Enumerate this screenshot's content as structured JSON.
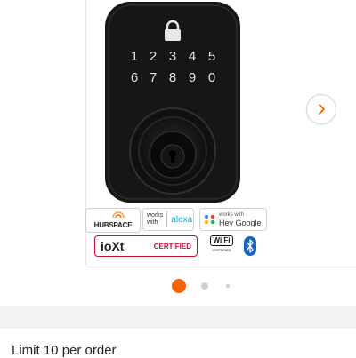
{
  "product": {
    "keypad_row1": [
      "1",
      "2",
      "3",
      "4",
      "5"
    ],
    "keypad_row2": [
      "6",
      "7",
      "8",
      "9",
      "0"
    ]
  },
  "badges": {
    "hubspace": "HUBSPACE",
    "alexa_works": "works",
    "alexa_with": "with",
    "alexa_name": "alexa",
    "google_small": "works with",
    "google_name": "Hey Google",
    "ioxt_brand": "ioXt",
    "ioxt_cert": "CERTIFIED",
    "wifi_label": "Wi Fi",
    "wifi_certified": "CERTIFIED"
  },
  "carousel": {
    "active_index": 0,
    "count": 3,
    "accent": "#f96302"
  },
  "purchase": {
    "limit_text": "Limit 10 per order"
  }
}
